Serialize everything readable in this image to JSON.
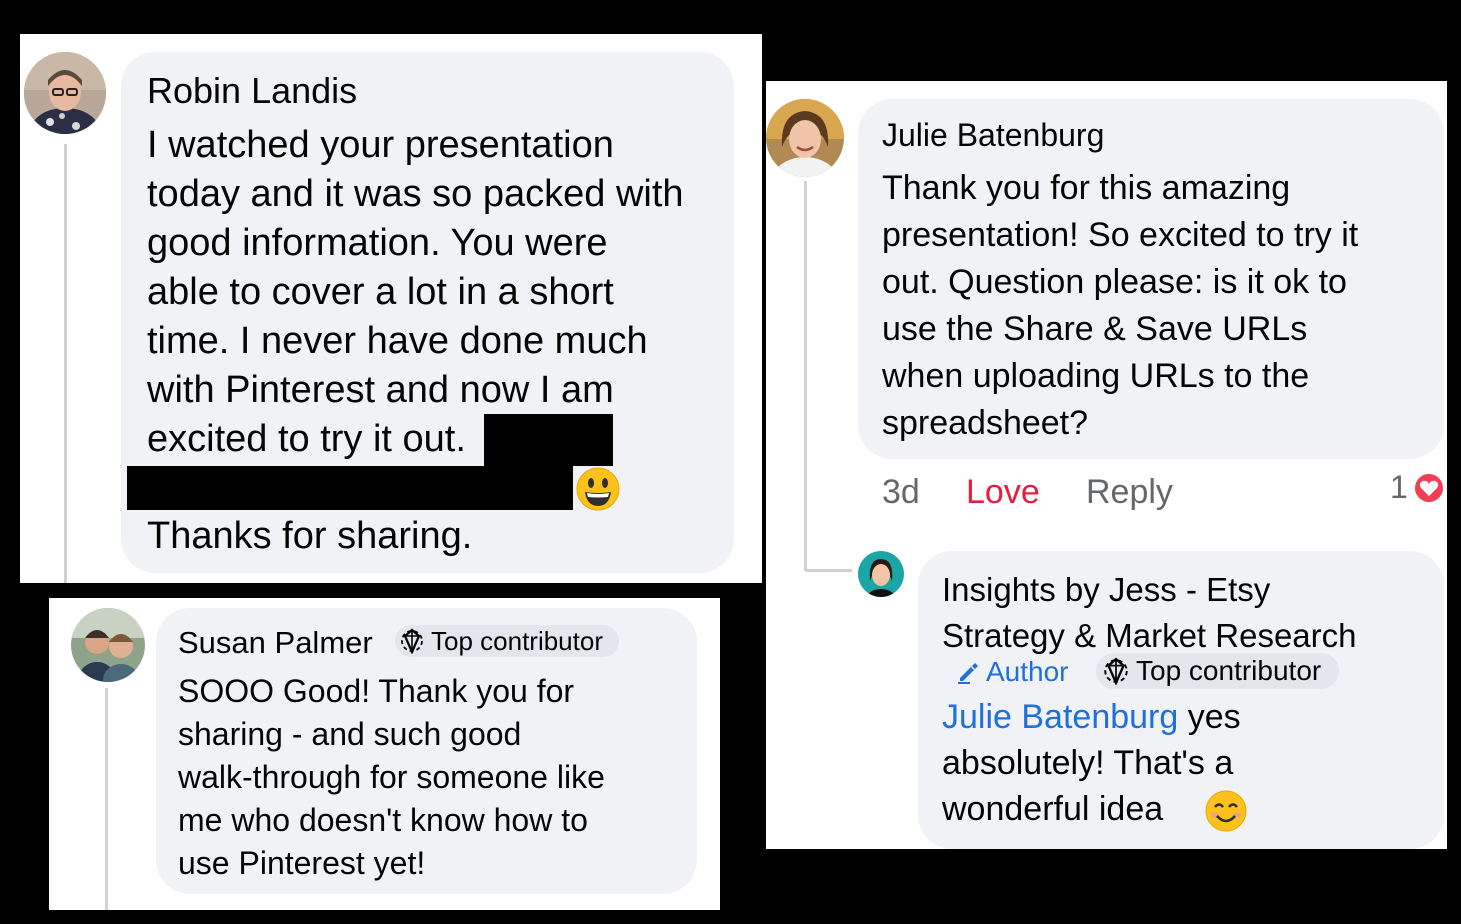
{
  "comments": {
    "robin": {
      "name": "Robin Landis",
      "lines": [
        "I watched your presentation",
        "today and it was so packed with",
        "good information. You were",
        "able to cover a lot in a short",
        "time. I never have done much",
        "with Pinterest and now I am",
        "excited to try it out."
      ],
      "closing": "Thanks for sharing."
    },
    "susan": {
      "name": "Susan Palmer",
      "badge": "Top contributor",
      "lines": [
        "SOOO Good! Thank you for",
        "sharing - and such good",
        "walk-through for someone like",
        "me who doesn't know how to",
        "use Pinterest yet!"
      ]
    },
    "julie": {
      "name": "Julie Batenburg",
      "lines": [
        "Thank you for this amazing",
        "presentation! So excited to try it",
        "out. Question please: is it ok to",
        "use the Share & Save URLs",
        "when uploading URLs to the",
        "spreadsheet?"
      ],
      "time": "3d",
      "reaction_label": "Love",
      "reply_label": "Reply",
      "reaction_count": "1"
    },
    "jess": {
      "name_line1": "Insights by Jess - Etsy",
      "name_line2": "Strategy & Market Research",
      "author_badge": "Author",
      "contributor_badge": "Top contributor",
      "mention": "Julie Batenburg",
      "text_line1": " yes",
      "text_line2": "absolutely! That's a",
      "text_line3": "wonderful idea"
    }
  },
  "colors": {
    "love": "#e41e3f",
    "link": "#216fdb",
    "meta": "#65676b"
  }
}
